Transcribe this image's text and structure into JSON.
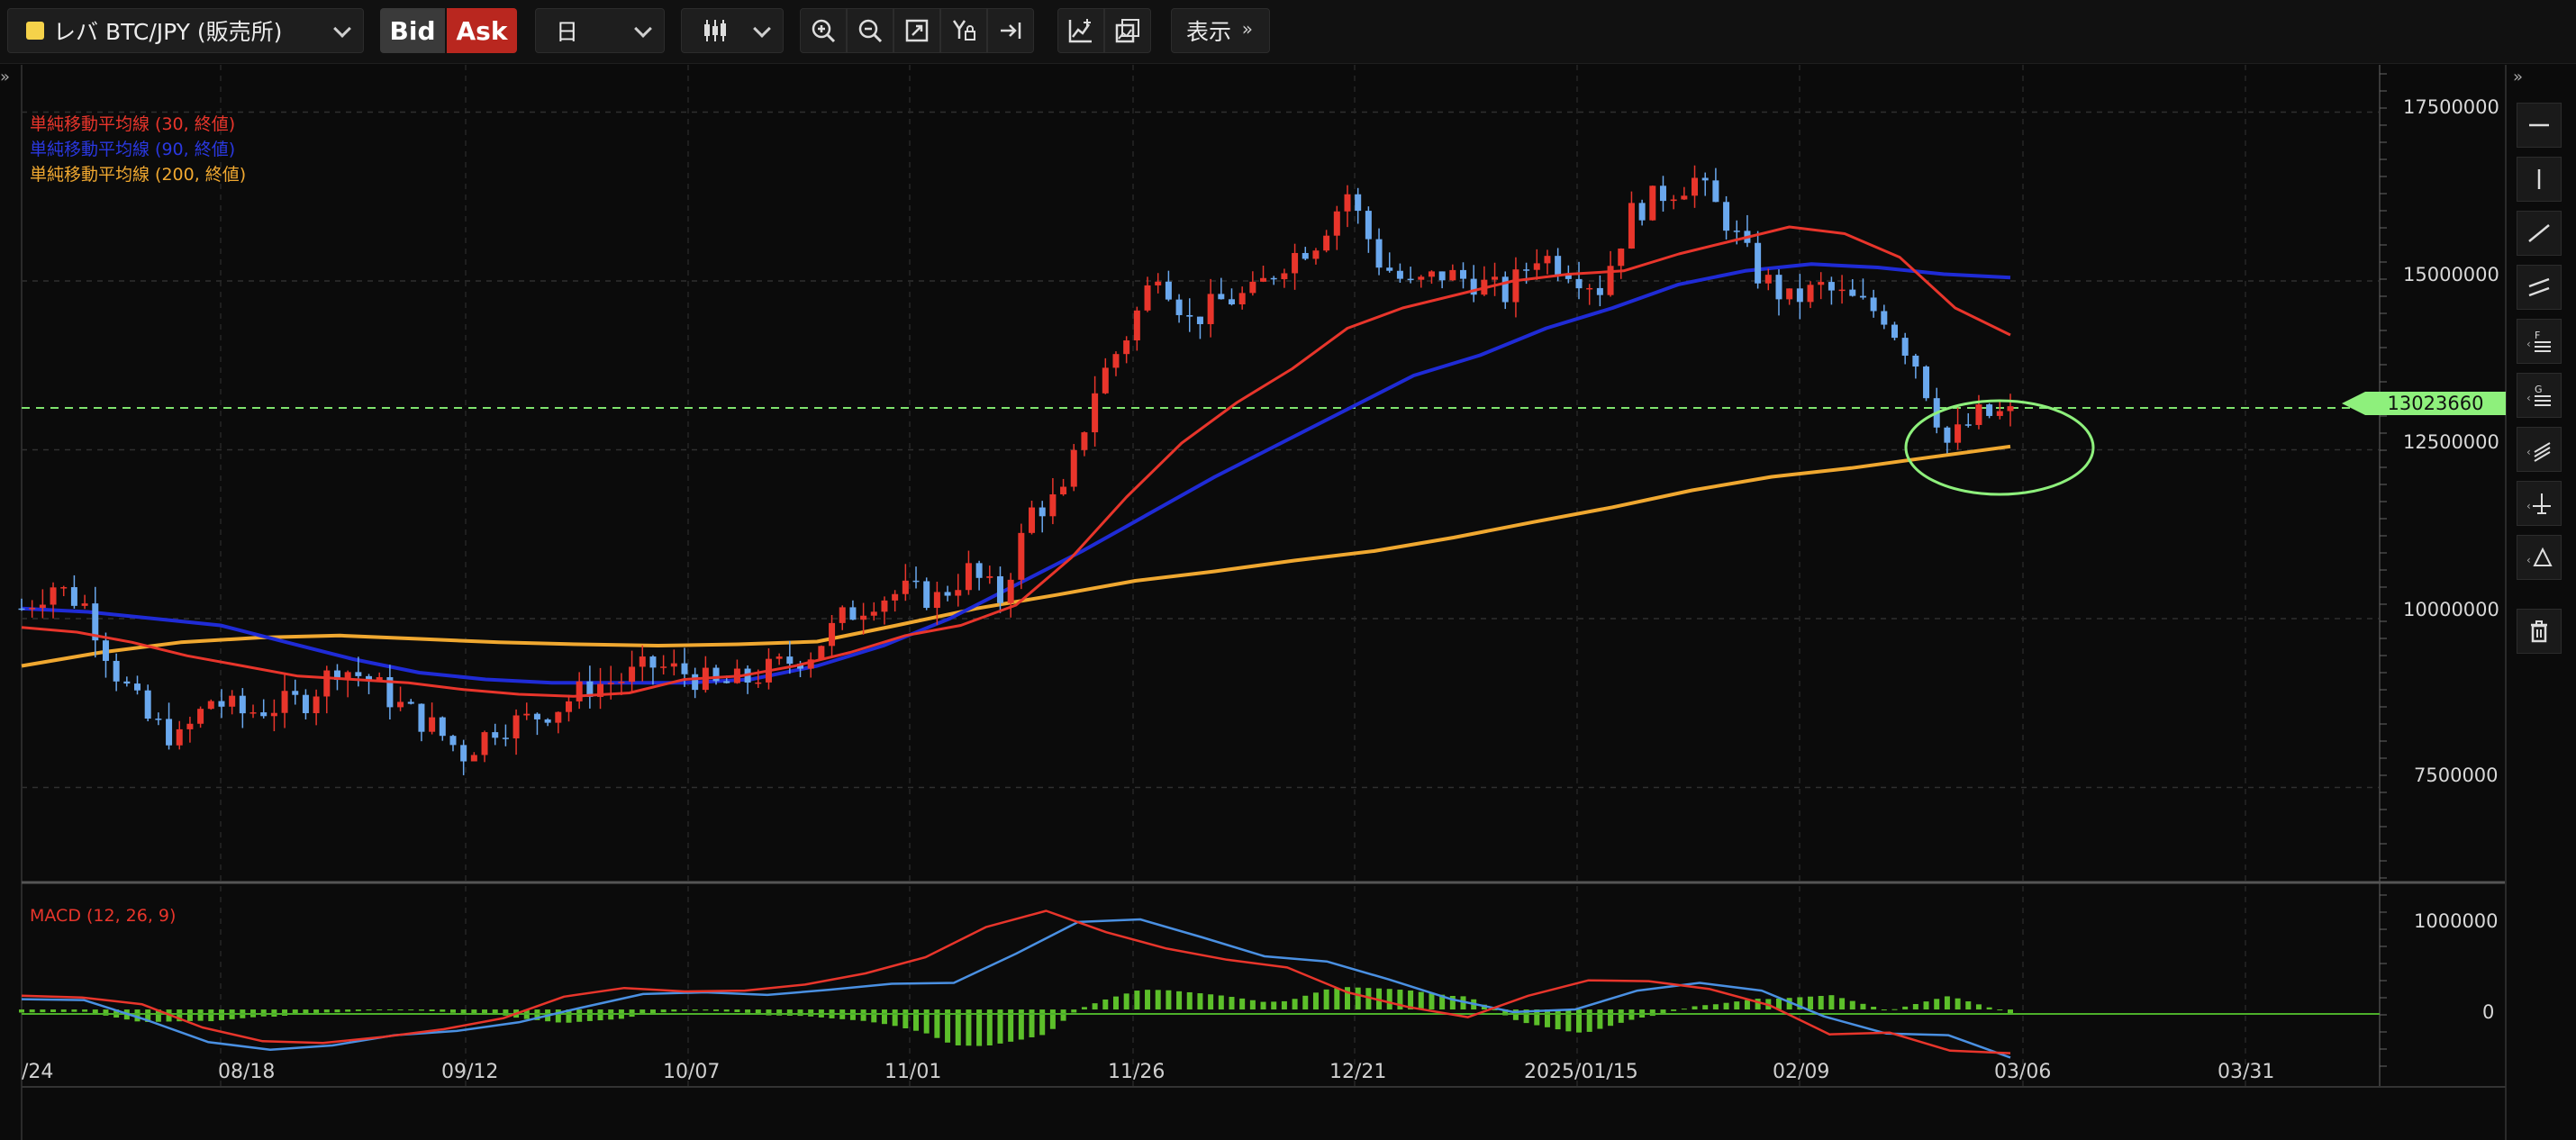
{
  "toolbar": {
    "symbol": "レバ BTC/JPY (販売所)",
    "bid_label": "Bid",
    "ask_label": "Ask",
    "timeframe": "日",
    "display_label": "表示"
  },
  "legend": {
    "sma30": "単純移動平均線 (30, 終値)",
    "sma90": "単純移動平均線 (90, 終値)",
    "sma200": "単純移動平均線 (200, 終値)",
    "macd": "MACD (12, 26, 9)"
  },
  "colors": {
    "up": "#e8352b",
    "down": "#6aa8ee",
    "sma30": "#e8352b",
    "sma90": "#1f2bd6",
    "sma200": "#f0a830",
    "macd_line": "#4a90e2",
    "signal_line": "#e8352b",
    "histogram": "#5cbf2a",
    "current_price": "#8ef07c"
  },
  "current_price": "13023660",
  "price_axis": [
    "17500000",
    "15000000",
    "12500000",
    "10000000",
    "7500000"
  ],
  "macd_axis": [
    "1000000",
    "0"
  ],
  "date_axis": [
    "/24",
    "08/18",
    "09/12",
    "10/07",
    "11/01",
    "11/26",
    "12/21",
    "2025/01/15",
    "02/09",
    "03/06",
    "03/31"
  ],
  "chart_data": {
    "type": "candlestick",
    "ylim": [
      6200000,
      18200000
    ],
    "last_close": 13023660,
    "sma30": [
      9870000,
      9800000,
      9650000,
      9450000,
      9300000,
      9150000,
      9100000,
      9050000,
      8950000,
      8880000,
      8850000,
      8900000,
      9100000,
      9150000,
      9300000,
      9500000,
      9750000,
      9900000,
      10200000,
      10900000,
      11800000,
      12600000,
      13200000,
      13700000,
      14300000,
      14600000,
      14800000,
      15000000,
      15100000,
      15150000,
      15400000,
      15600000,
      15800000,
      15700000,
      15350000,
      14600000,
      14200000
    ],
    "sma90": [
      10150000,
      10100000,
      10000000,
      9900000,
      9650000,
      9400000,
      9200000,
      9100000,
      9050000,
      9050000,
      9050000,
      9100000,
      9300000,
      9600000,
      10000000,
      10500000,
      11000000,
      11550000,
      12100000,
      12600000,
      13100000,
      13600000,
      13900000,
      14300000,
      14600000,
      14950000,
      15150000,
      15250000,
      15200000,
      15100000,
      15050000
    ],
    "sma200": [
      9300000,
      9500000,
      9650000,
      9720000,
      9750000,
      9700000,
      9650000,
      9620000,
      9600000,
      9620000,
      9660000,
      9900000,
      10150000,
      10350000,
      10560000,
      10700000,
      10860000,
      11000000,
      11200000,
      11430000,
      11650000,
      11900000,
      12100000,
      12230000,
      12390000,
      12550000
    ],
    "macd_ylim": [
      -850000,
      1250000
    ],
    "macd": [
      120000,
      110000,
      -120000,
      -380000,
      -470000,
      -420000,
      -300000,
      -250000,
      -150000,
      20000,
      180000,
      200000,
      170000,
      230000,
      300000,
      310000,
      650000,
      1020000,
      1050000,
      840000,
      620000,
      560000,
      350000,
      120000,
      -30000,
      0,
      220000,
      310000,
      220000,
      -80000,
      -280000,
      -300000,
      -560000
    ],
    "signal": [
      160000,
      140000,
      60000,
      -210000,
      -370000,
      -390000,
      -320000,
      -230000,
      -100000,
      150000,
      250000,
      210000,
      220000,
      290000,
      420000,
      610000,
      960000,
      1150000,
      900000,
      710000,
      580000,
      490000,
      200000,
      30000,
      -90000,
      160000,
      340000,
      330000,
      240000,
      50000,
      -290000,
      -270000,
      -480000,
      -510000
    ]
  }
}
